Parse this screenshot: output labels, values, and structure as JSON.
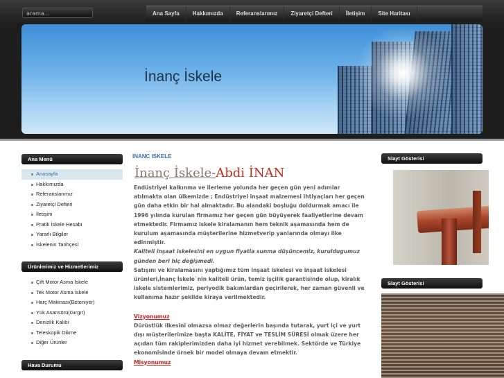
{
  "search": {
    "placeholder": "arama..."
  },
  "nav": [
    "Ana Sayfa",
    "Hakkımızda",
    "Referanslarımız",
    "Ziyaretçi Defteri",
    "İletişim",
    "Site Haritası"
  ],
  "banner": {
    "title": "İnanç İskele"
  },
  "sidebar": {
    "menu_title": "Ana Menü",
    "menu": [
      "Anasayfa",
      "Hakkımızda",
      "Referanslarımız",
      "Ziyaretçi Defteri",
      "İletişim",
      "Pratik İskele Hesabı",
      "Yararlı Bilgiler",
      "İskelenin Tarihçesi"
    ],
    "products_title": "Ürünlerimiz ve Hizmetlerimiz",
    "products": [
      "Çift Motor Asma İskele",
      "Tek Motor Asma İskele",
      "Harç Makinası(Betoniyer)",
      "Yük Asansörü(Gırgır)",
      "Denizlik Kalıbı",
      "Teleskopik Dikme",
      "Diğer Ürünler"
    ],
    "weather_title": "Hava Durumu"
  },
  "main": {
    "breadcrumb": "INANC ISKELE",
    "heading_part1": "İnanç İskele-",
    "heading_part2": "Abdi İNAN",
    "p1": "Endüstriyel kalkınma ve ilerleme yolunda her geçen gün yeni adımlar atılmakta olan ülkemizde ; Endüstriyel inşaat malzemesi ihtiyaçları her geçen gün daha etkin bir hal almaktadır. Bu alandaki boşluğu doldurmak amacı ile 1996 yılında kurulan firmamız her geçen gün büyüyerek faaliyetlerine devam etmektedir. Firmamız iskele kiralamanın hem teknik aşamasında hem de kurulum aşamasında müşterilerine hizmetverip yanlarında olmayı ilke edinmiştir.",
    "p2": "Kaliteli inşaat iskelesini en uygun fiyatla sunma düşüncemiz, kuruldugumuz günden beri hiç değişmedi.",
    "p3": "Satışını ve kiralamasını yaptığımız tüm inşaat iskelesi ve inşaat iskelesi ürünleri,İnanç İskele`nin kaliteli ürün, temiz işçilik garantisinde olup, kiralık iskele sistemlerimiz, periyodik bakımlardan geçirilerek, her zaman güvenli ve kullanıma hazır şekilde kiraya verilmektedir.",
    "vision_title": "Vizyonumuz",
    "vision_text": "Dürüstlük ilkesini olmazsa olmaz değerlerin başında tutarak, yurt içi ve yurt dışı müşterilerimize başta KALİTE, FİYAT ve TESLİM SÜRESİ olmak üzere her açıdan tüm rakiplerimizden daha iyi hizmet verebilmek. Sektörde ve Türkiye ekonomisinde örnek bir model olmaya devam etmektir.",
    "mission_title": "Misyonumuz"
  },
  "right": {
    "slideshow1_title": "Slayt Gösterisi",
    "slideshow2_title": "Slayt Gösterisi"
  }
}
